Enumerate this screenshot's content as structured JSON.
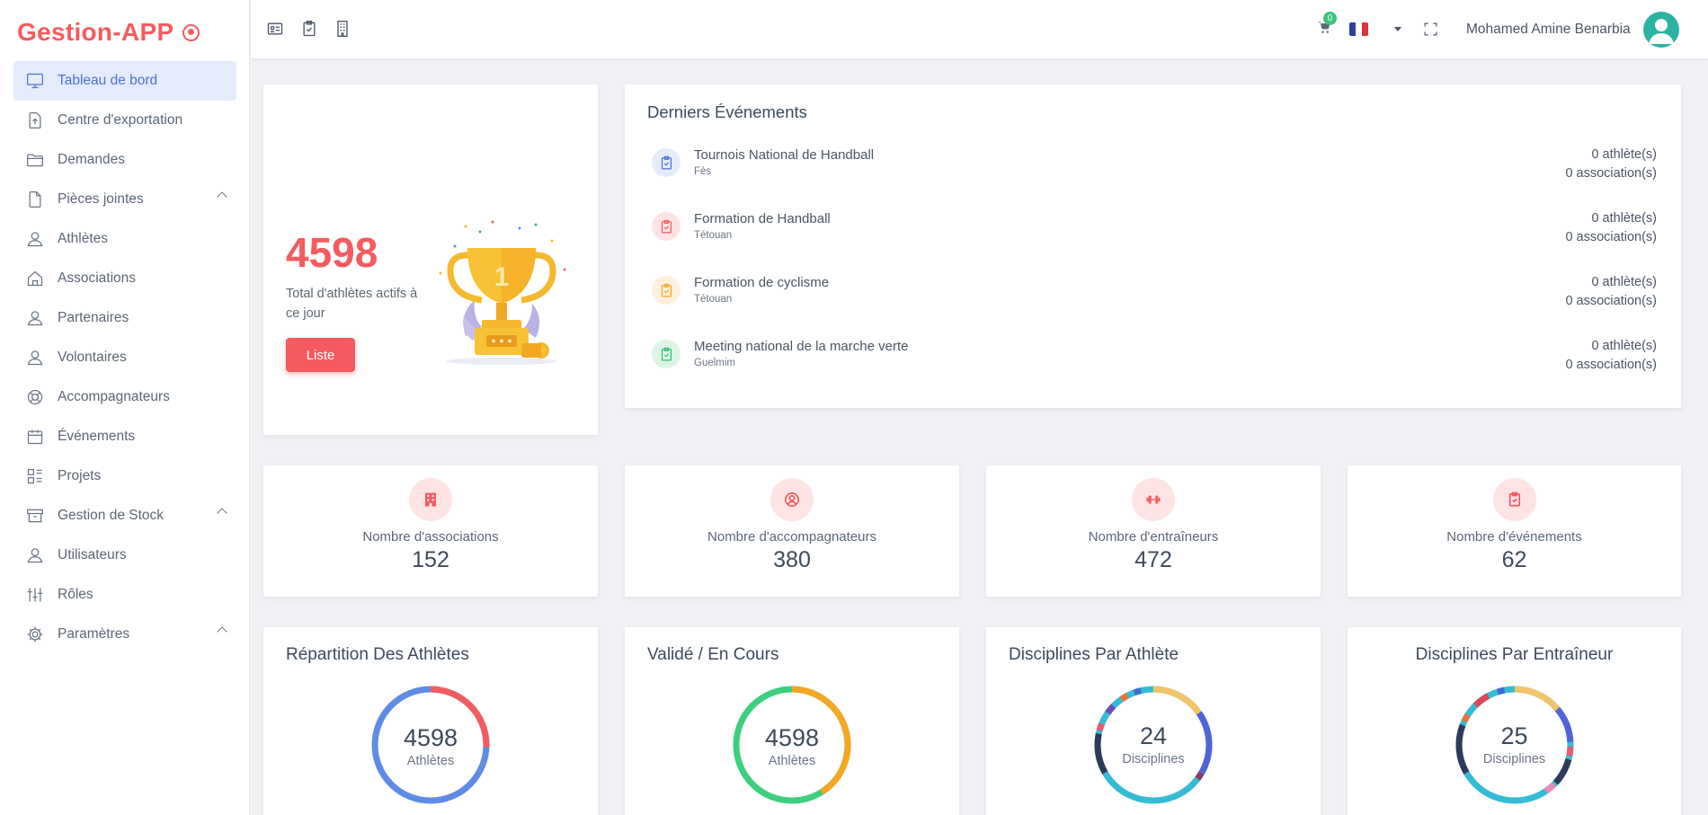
{
  "app": {
    "title": "Gestion-APP"
  },
  "sidebar": {
    "items": [
      {
        "label": "Tableau de bord",
        "icon": "monitor-icon"
      },
      {
        "label": "Centre d'exportation",
        "icon": "upload-file-icon"
      },
      {
        "label": "Demandes",
        "icon": "folder-icon"
      },
      {
        "label": "Pièces jointes",
        "icon": "file-icon"
      },
      {
        "label": "Athlètes",
        "icon": "user-icon"
      },
      {
        "label": "Associations",
        "icon": "home-icon"
      },
      {
        "label": "Partenaires",
        "icon": "user-icon"
      },
      {
        "label": "Volontaires",
        "icon": "user-icon"
      },
      {
        "label": "Accompagnateurs",
        "icon": "lifebuoy-icon"
      },
      {
        "label": "Événements",
        "icon": "calendar-icon"
      },
      {
        "label": "Projets",
        "icon": "layout-icon"
      },
      {
        "label": "Gestion de Stock",
        "icon": "archive-icon"
      },
      {
        "label": "Utilisateurs",
        "icon": "user-icon"
      },
      {
        "label": "Rôles",
        "icon": "sliders-icon"
      },
      {
        "label": "Paramètres",
        "icon": "gear-icon"
      }
    ]
  },
  "topbar": {
    "cart_count": "0",
    "username": "Mohamed Amine Benarbia"
  },
  "hero": {
    "number": "4598",
    "description": "Total d'athlètes actifs à ce jour",
    "button_label": "Liste",
    "trophy_rank": "1"
  },
  "events": {
    "title": "Derniers Événements",
    "items": [
      {
        "name": "Tournois National de Handball",
        "city": "Fès",
        "athletes": "0 athlète(s)",
        "associations": "0 association(s)",
        "color": "#4a72d9",
        "bg": "#e4ebfa"
      },
      {
        "name": "Formation de Handball",
        "city": "Tétouan",
        "athletes": "0 athlète(s)",
        "associations": "0 association(s)",
        "color": "#f45b5f",
        "bg": "#fde3e4"
      },
      {
        "name": "Formation de cyclisme",
        "city": "Tétouan",
        "athletes": "0 athlète(s)",
        "associations": "0 association(s)",
        "color": "#f5a623",
        "bg": "#fdf0dc"
      },
      {
        "name": "Meeting national de la marche verte",
        "city": "Guelmim",
        "athletes": "0 athlète(s)",
        "associations": "0 association(s)",
        "color": "#2fbf71",
        "bg": "#dcf5e7"
      }
    ]
  },
  "stats": [
    {
      "label": "Nombre d'associations",
      "value": "152",
      "icon": "building-icon"
    },
    {
      "label": "Nombre d'accompagnateurs",
      "value": "380",
      "icon": "user-circle-icon"
    },
    {
      "label": "Nombre d'entraîneurs",
      "value": "472",
      "icon": "dumbbell-icon"
    },
    {
      "label": "Nombre d'événements",
      "value": "62",
      "icon": "clipboard-check-icon"
    }
  ],
  "donuts": [
    {
      "title": "Répartition Des Athlètes",
      "value": "4598",
      "sub": "Athlètes"
    },
    {
      "title": "Validé / En Cours",
      "value": "4598",
      "sub": "Athlètes"
    },
    {
      "title": "Disciplines Par Athlète",
      "value": "24",
      "sub": "Disciplines"
    },
    {
      "title": "Disciplines Par Entraîneur",
      "value": "25",
      "sub": "Disciplines"
    }
  ],
  "colors": {
    "accent": "#f45b5f",
    "active_bg": "#e4ebfa",
    "active_text": "#4a72d9"
  }
}
